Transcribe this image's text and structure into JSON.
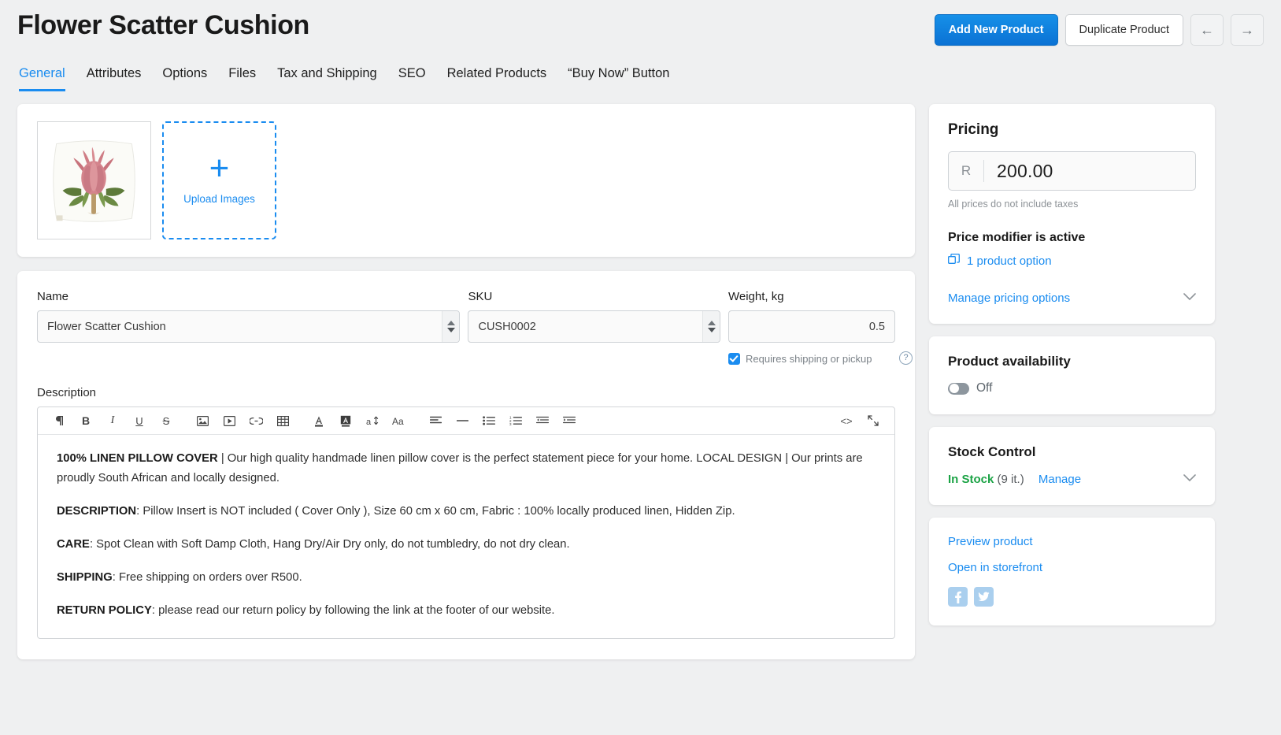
{
  "header": {
    "title": "Flower Scatter Cushion",
    "add_new_product": "Add New Product",
    "duplicate_product": "Duplicate Product",
    "prev_arrow": "←",
    "next_arrow": "→"
  },
  "tabs": [
    {
      "label": "General",
      "active": true
    },
    {
      "label": "Attributes",
      "active": false
    },
    {
      "label": "Options",
      "active": false
    },
    {
      "label": "Files",
      "active": false
    },
    {
      "label": "Tax and Shipping",
      "active": false
    },
    {
      "label": "SEO",
      "active": false
    },
    {
      "label": "Related Products",
      "active": false
    },
    {
      "label": "“Buy Now” Button",
      "active": false
    }
  ],
  "images": {
    "upload_plus": "+",
    "upload_label": "Upload Images"
  },
  "form": {
    "name_label": "Name",
    "name_value": "Flower Scatter Cushion",
    "sku_label": "SKU",
    "sku_value": "CUSH0002",
    "weight_label": "Weight, kg",
    "weight_value": "0.5",
    "requires_shipping_label": "Requires shipping or pickup",
    "help_glyph": "?",
    "description_label": "Description"
  },
  "editor": {
    "tools": [
      "paragraph-icon",
      "bold-icon",
      "italic-icon",
      "underline-icon",
      "strikethrough-icon",
      "image-icon",
      "video-icon",
      "link-icon",
      "table-icon",
      "text-color-icon",
      "highlight-color-icon",
      "font-size-icon",
      "font-family-icon",
      "align-icon",
      "horizontal-rule-icon",
      "bullet-list-icon",
      "numbered-list-icon",
      "outdent-icon",
      "indent-icon",
      "source-code-icon",
      "fullscreen-icon"
    ],
    "source_glyph": "<>",
    "paragraphs": [
      {
        "bold": "100% LINEN PILLOW COVER",
        "rest": " | Our high quality handmade linen pillow cover is the perfect statement piece for your home. LOCAL DESIGN | Our prints are proudly South African and locally designed."
      },
      {
        "bold": "DESCRIPTION",
        "rest": ": Pillow Insert is NOT included ( Cover Only ), Size 60 cm x 60 cm, Fabric : 100% locally produced linen, Hidden Zip."
      },
      {
        "bold": "CARE",
        "rest": ": Spot Clean with Soft Damp Cloth, Hang Dry/Air Dry only, do not tumbledry, do not dry clean."
      },
      {
        "bold": "SHIPPING",
        "rest": ": Free shipping on orders over R500."
      },
      {
        "bold": "RETURN POLICY",
        "rest": ": please read our return policy by following the link at the footer of our website."
      }
    ]
  },
  "pricing": {
    "title": "Pricing",
    "currency": "R",
    "value": "200.00",
    "tax_note": "All prices do not include taxes",
    "modifier_title": "Price modifier is active",
    "product_option_link": "1 product option",
    "manage_link": "Manage pricing options",
    "chevron": "⌄"
  },
  "availability": {
    "title": "Product availability",
    "state": "Off"
  },
  "stock": {
    "title": "Stock Control",
    "status": "In Stock",
    "quantity": "(9 it.)",
    "manage": "Manage",
    "chevron": "⌄"
  },
  "links": {
    "preview": "Preview product",
    "storefront": "Open in storefront",
    "social": [
      "facebook-icon",
      "twitter-icon"
    ]
  },
  "colors": {
    "accent": "#1a8cf0",
    "primary_button": "#0b72d4",
    "in_stock": "#1ba345",
    "page_bg": "#eff0f1"
  }
}
